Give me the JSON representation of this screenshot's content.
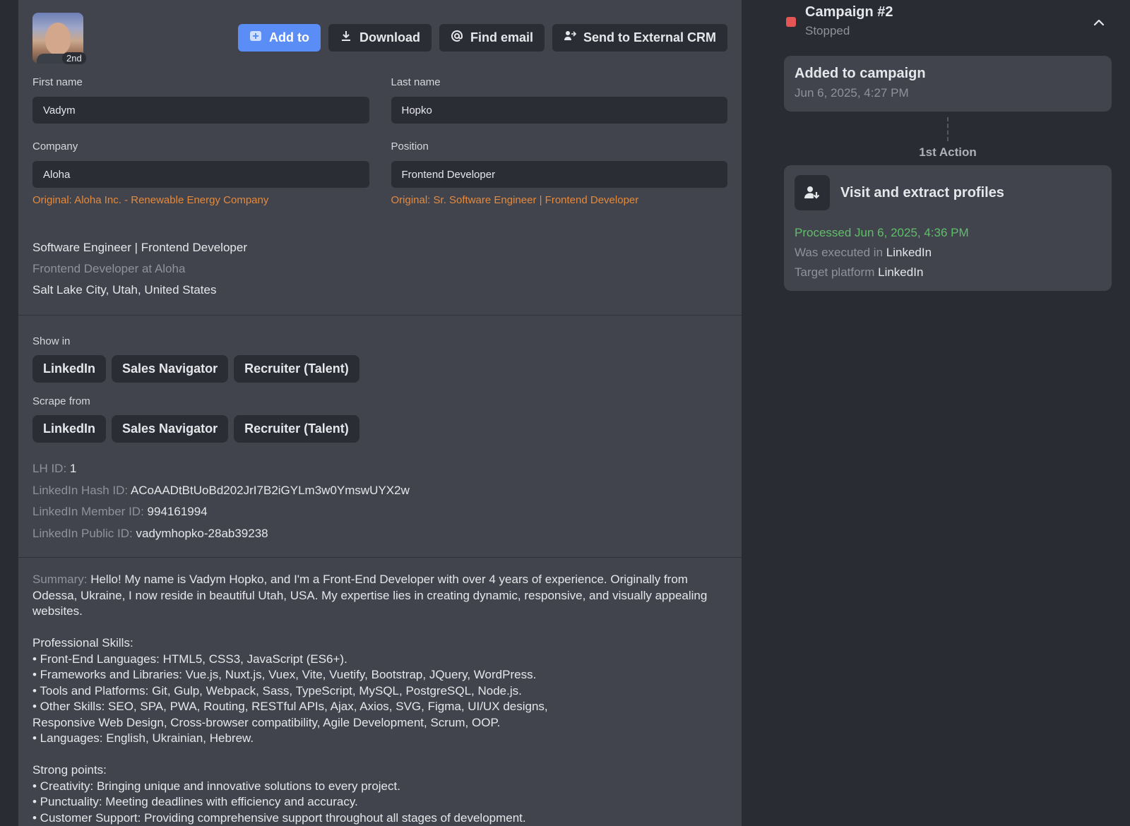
{
  "profile": {
    "degree": "2nd",
    "actions": {
      "add_to": "Add to",
      "download": "Download",
      "find_email": "Find email",
      "send_crm": "Send to External CRM"
    },
    "first_name_label": "First name",
    "first_name": "Vadym",
    "last_name_label": "Last name",
    "last_name": "Hopko",
    "company_label": "Company",
    "company": "Aloha",
    "company_original": "Original: Aloha Inc. - Renewable Energy Company",
    "position_label": "Position",
    "position": "Frontend Developer",
    "position_original": "Original: Sr. Software Engineer | Frontend Developer",
    "headline": "Software Engineer | Frontend Developer",
    "subheadline": "Frontend Developer at Aloha",
    "location": "Salt Lake City, Utah, United States",
    "show_in_label": "Show in",
    "show_in": [
      "LinkedIn",
      "Sales Navigator",
      "Recruiter (Talent)"
    ],
    "scrape_from_label": "Scrape from",
    "scrape_from": [
      "LinkedIn",
      "Sales Navigator",
      "Recruiter (Talent)"
    ],
    "ids": {
      "lh_id_label": "LH ID:",
      "lh_id": "1",
      "hash_label": "LinkedIn Hash ID:",
      "hash": "ACoAADtBtUoBd202JrI7B2iGYLm3w0YmswUYX2w",
      "member_label": "LinkedIn Member ID:",
      "member": "994161994",
      "public_label": "LinkedIn Public ID:",
      "public": "vadymhopko-28ab39238"
    },
    "summary_label": "Summary:",
    "summary": "Hello! My name is Vadym Hopko, and I'm a Front-End Developer with over 4 years of experience. Originally from Odessa, Ukraine, I now reside in beautiful Utah, USA. My expertise lies in creating dynamic, responsive, and visually appealing websites.\n\nProfessional Skills:\n• Front-End Languages: HTML5, CSS3, JavaScript (ES6+).\n• Frameworks and Libraries: Vue.js, Nuxt.js, Vuex, Vite, Vuetify, Bootstrap, JQuery, WordPress.\n• Tools and Platforms: Git, Gulp, Webpack, Sass, TypeScript, MySQL, PostgreSQL, Node.js.\n• Other Skills: SEO, SPA, PWA, Routing, RESTful APIs, Ajax, Axios, SVG, Figma, UI/UX designs,\nResponsive Web Design, Cross-browser compatibility, Agile Development, Scrum, OOP.\n• Languages: English, Ukrainian, Hebrew.\n\nStrong points:\n• Creativity: Bringing unique and innovative solutions to every project.\n• Punctuality: Meeting deadlines with efficiency and accuracy.\n• Customer Support: Providing comprehensive support throughout all stages of development."
  },
  "campaign": {
    "title": "Campaign #2",
    "status": "Stopped",
    "status_color": "#e45656",
    "added_title": "Added to campaign",
    "added_date": "Jun 6, 2025, 4:27 PM",
    "action_label": "1st Action",
    "action_title": "Visit and extract profiles",
    "processed": "Processed Jun 6, 2025, 4:36 PM",
    "executed_label": "Was executed in",
    "executed_value": "LinkedIn",
    "target_label": "Target platform",
    "target_value": "LinkedIn"
  },
  "colors": {
    "accent": "#5b8df6",
    "warning_text": "#e58a3a",
    "success_text": "#5fbf69"
  },
  "icons": [
    "add-to-icon",
    "download-icon",
    "at-sign-icon",
    "crm-users-icon",
    "chevron-up-icon",
    "user-download-icon"
  ]
}
